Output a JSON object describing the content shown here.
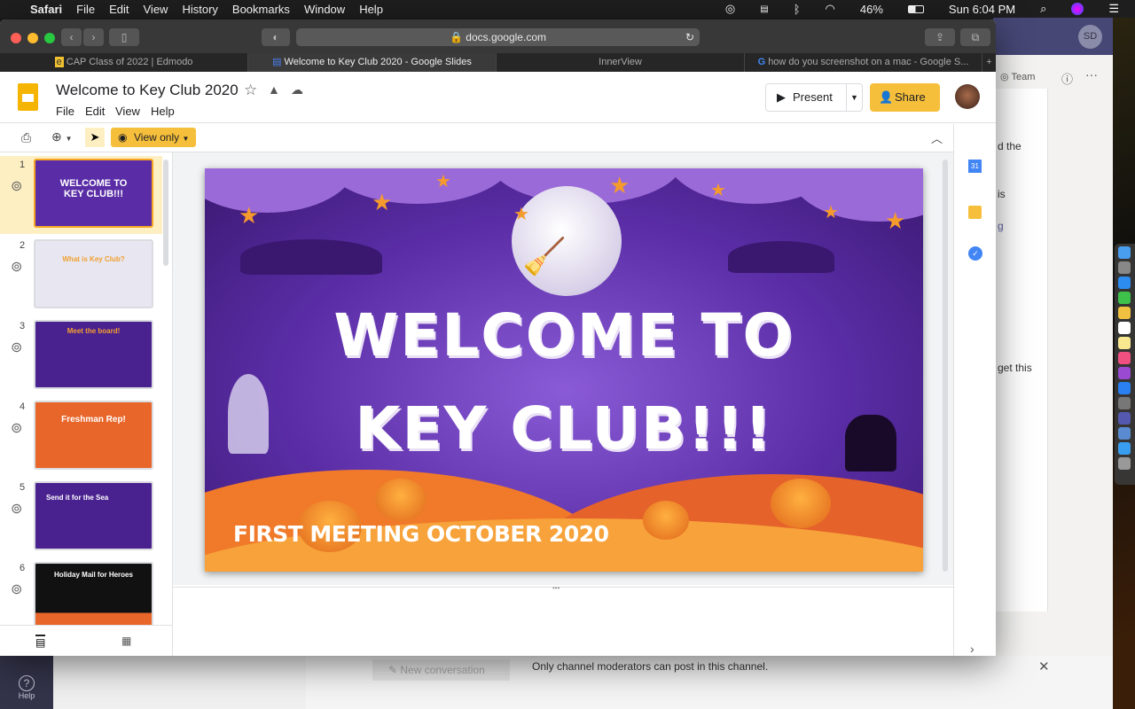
{
  "menubar": {
    "items": [
      "Safari",
      "File",
      "Edit",
      "View",
      "History",
      "Bookmarks",
      "Window",
      "Help"
    ],
    "battery": "46%",
    "clock": "Sun 6:04 PM"
  },
  "browser": {
    "url": "docs.google.com",
    "tabs": [
      "CAP Class of 2022 | Edmodo",
      "Welcome to Key Club 2020 - Google Slides",
      "InnerView",
      "how do you screenshot on a mac - Google S..."
    ],
    "new_tab": "+"
  },
  "slides": {
    "title": "Welcome to Key Club 2020",
    "menus": [
      "File",
      "Edit",
      "View",
      "Help"
    ],
    "present": "Present",
    "share": "Share",
    "view_only": "View only",
    "thumbnails": [
      {
        "num": "1",
        "title": "WELCOME TO KEY CLUB!!!",
        "bg": "#5a2da6"
      },
      {
        "num": "2",
        "title": "What is Key Club?",
        "bg": "#e8e6f0"
      },
      {
        "num": "3",
        "title": "Meet the board!",
        "bg": "#4a2290"
      },
      {
        "num": "4",
        "title": "Freshman Rep!",
        "bg": "#e8662a"
      },
      {
        "num": "5",
        "title": "Send it for the Sea",
        "bg": "#4a2290"
      },
      {
        "num": "6",
        "title": "Holiday Mail for Heroes",
        "bg": "#111111"
      }
    ],
    "main_slide": {
      "line1": "WELCOME TO",
      "line2": "KEY CLUB!!!",
      "subtitle": "FIRST MEETING OCTOBER 2020"
    }
  },
  "side_icons": [
    "calendar-icon",
    "keep-icon",
    "tasks-icon"
  ],
  "calendar_day": "31",
  "teams": {
    "avatar": "SD",
    "team_label": "Team",
    "snippets": [
      "d the",
      "is",
      "g",
      "get this"
    ],
    "new_conversation": "New conversation",
    "notice": "Only channel moderators can post in this channel.",
    "help": "Help"
  }
}
